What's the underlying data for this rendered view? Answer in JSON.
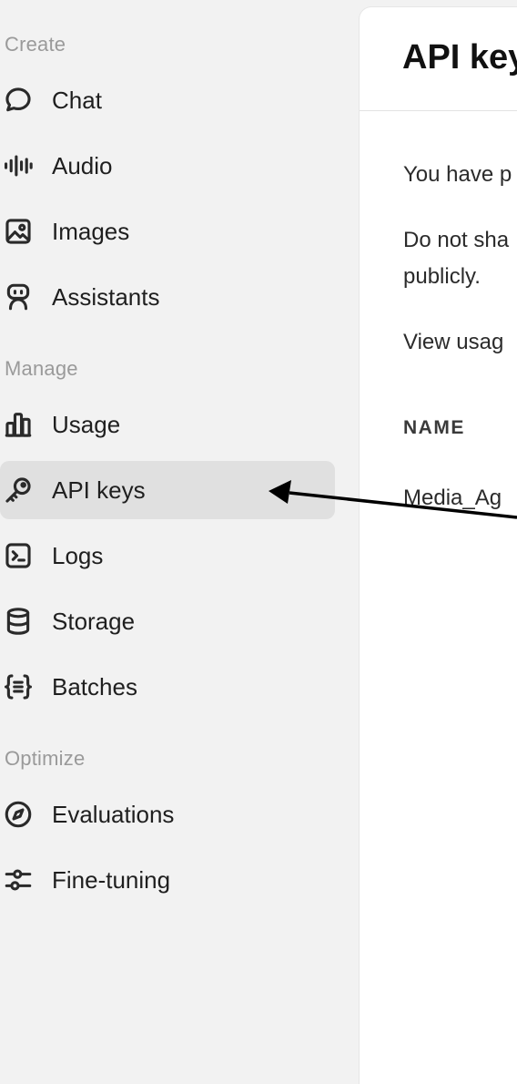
{
  "sidebar": {
    "sections": [
      {
        "label": "Create",
        "items": [
          {
            "label": "Chat",
            "icon": "chat-bubble-icon"
          },
          {
            "label": "Audio",
            "icon": "waveform-icon"
          },
          {
            "label": "Images",
            "icon": "image-icon"
          },
          {
            "label": "Assistants",
            "icon": "robot-icon"
          }
        ]
      },
      {
        "label": "Manage",
        "items": [
          {
            "label": "Usage",
            "icon": "bar-chart-icon"
          },
          {
            "label": "API keys",
            "icon": "key-icon",
            "active": true
          },
          {
            "label": "Logs",
            "icon": "terminal-icon"
          },
          {
            "label": "Storage",
            "icon": "database-icon"
          },
          {
            "label": "Batches",
            "icon": "braces-list-icon"
          }
        ]
      },
      {
        "label": "Optimize",
        "items": [
          {
            "label": "Evaluations",
            "icon": "compass-icon"
          },
          {
            "label": "Fine-tuning",
            "icon": "sliders-icon"
          }
        ]
      }
    ]
  },
  "main": {
    "title": "API key",
    "paragraphs": [
      "You have p",
      "Do not sha",
      "publicly.",
      "View usag"
    ],
    "table": {
      "column_header": "NAME",
      "rows": [
        {
          "name": "Media_Ag"
        }
      ]
    }
  },
  "colors": {
    "sidebar_bg": "#f2f2f2",
    "active_item_bg": "#e0e0e0",
    "main_bg": "#ffffff",
    "section_label": "#9a9a9a",
    "annotation_arrow": "#000000"
  }
}
